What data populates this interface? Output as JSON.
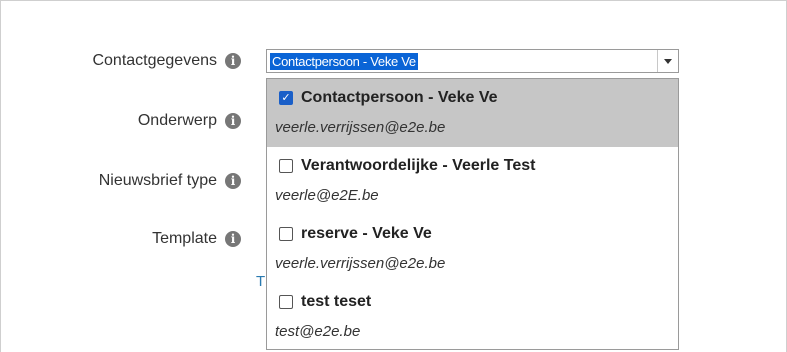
{
  "form": {
    "labels": [
      {
        "key": "contact",
        "text": "Contactgegevens"
      },
      {
        "key": "subject",
        "text": "Onderwerp"
      },
      {
        "key": "newsletter_type",
        "text": "Nieuwsbrief type"
      },
      {
        "key": "template",
        "text": "Template"
      }
    ],
    "info_icon_glyph": "i",
    "select_value": "Contactpersoon - Veke Ve",
    "peek_link_text": "T"
  },
  "dropdown": {
    "options": [
      {
        "title": "Contactpersoon - Veke Ve",
        "email": "veerle.verrijssen@e2e.be",
        "checked": true
      },
      {
        "title": "Verantwoordelijke - Veerle Test",
        "email": "veerle@e2E.be",
        "checked": false
      },
      {
        "title": "reserve - Veke Ve",
        "email": "veerle.verrijssen@e2e.be",
        "checked": false
      },
      {
        "title": "test teset",
        "email": "test@e2e.be",
        "checked": false
      }
    ]
  },
  "colors": {
    "selection_blue": "#0a64d6",
    "selected_row_bg": "#c6c6c6",
    "checkbox_checked": "#1a5fc8",
    "link": "#2a7ab0"
  },
  "icons": {
    "info": "info-circle-icon",
    "dropdown_arrow": "chevron-down-icon",
    "checkmark": "check-icon"
  }
}
